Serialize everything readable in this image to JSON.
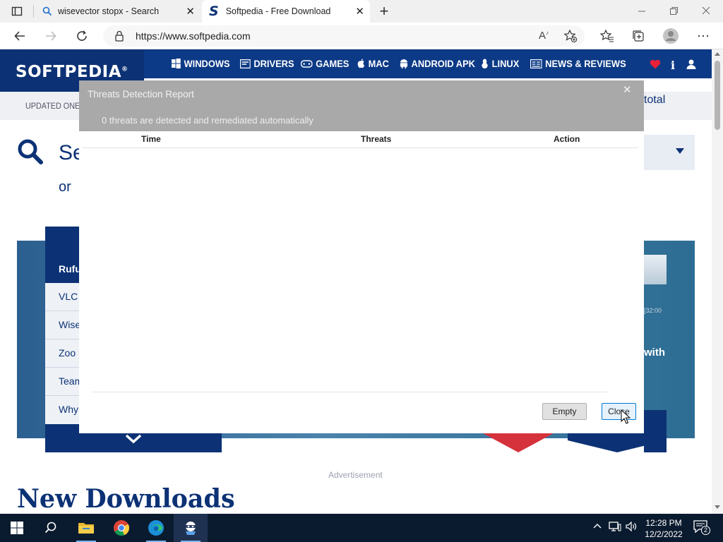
{
  "browser": {
    "tabs": [
      {
        "title": "wisevector stopx - Search",
        "icon": "search-icon"
      },
      {
        "title": "Softpedia - Free Downloads Encyclopedia",
        "icon": "softpedia-s-icon"
      }
    ],
    "url": "https://www.softpedia.com"
  },
  "page": {
    "logo": "SOFTPEDIA",
    "nav": [
      "WINDOWS",
      "DRIVERS",
      "GAMES",
      "MAC",
      "ANDROID APK",
      "LINUX",
      "NEWS & REVIEWS"
    ],
    "updated": "UPDATED ONE M",
    "total_partial": "total",
    "search_partial": "Se",
    "or_partial": "or",
    "list_items": [
      "Rufu",
      "VLC",
      "Wise",
      "Zoo",
      "Team",
      "Why"
    ],
    "with_partial": "with",
    "advertisement": "Advertisement",
    "new_downloads": "New Downloads"
  },
  "dialog": {
    "title": "Threats Detection Report",
    "subtitle": "0 threats are detected and remediated automatically",
    "columns": [
      "Time",
      "Threats",
      "Action"
    ],
    "rows": [],
    "empty_button": "Empty",
    "close_button": "Close"
  },
  "taskbar": {
    "time": "12:28 PM",
    "date": "12/2/2022",
    "notification_count": "2"
  }
}
